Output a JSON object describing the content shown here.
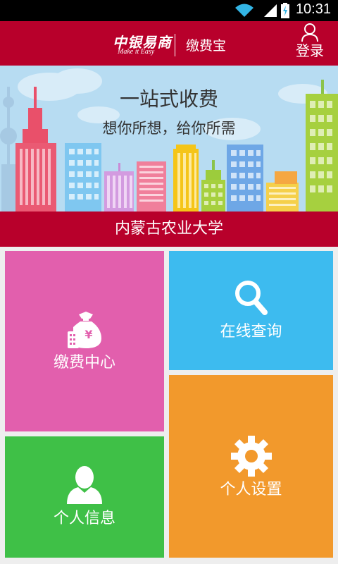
{
  "status_bar": {
    "time": "10:31",
    "icons": [
      "wifi-icon",
      "signal-icon",
      "battery-charging-icon"
    ]
  },
  "header": {
    "logo_cn": "中银易商",
    "logo_en": "Make it Easy",
    "app_name": "缴费宝",
    "login_label": "登录",
    "login_icon": "user-icon",
    "background": "#b8002b"
  },
  "banner": {
    "title": "一站式收费",
    "subtitle": "想你所想，给你所需"
  },
  "school": {
    "name": "内蒙古农业大学"
  },
  "tiles": {
    "pay": {
      "label": "缴费中心",
      "icon": "money-bag-icon",
      "color": "#e25fad"
    },
    "query": {
      "label": "在线查询",
      "icon": "search-icon",
      "color": "#3dbbef"
    },
    "info": {
      "label": "个人信息",
      "icon": "person-icon",
      "color": "#3fc047"
    },
    "settings": {
      "label": "个人设置",
      "icon": "gear-icon",
      "color": "#f2992c"
    }
  }
}
